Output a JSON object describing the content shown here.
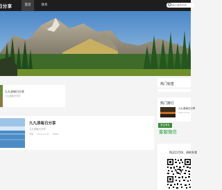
{
  "app": {
    "brand": "日分享"
  },
  "nav": {
    "items": [
      {
        "label": "首页"
      },
      {
        "label": "联系"
      }
    ]
  },
  "search": {
    "placeholder": "输入搜索内容"
  },
  "articles": [
    {
      "title": "九九浪每日分享",
      "subtitle": "九九浪每日分享",
      "meta": []
    },
    {
      "title": "九九浪每日分享",
      "subtitle": "九九浪每日分享",
      "meta": [
        "博客",
        "2024-12-30",
        "18882"
      ]
    }
  ],
  "sidebar": {
    "hot_tags": {
      "title": "热门标签"
    },
    "hot_rank": {
      "title": "热门排行",
      "item": {
        "title": "九九浪每日分享",
        "date": "2024-12-30"
      }
    },
    "follow_label": "关注有礼",
    "service_label": "客服微信",
    "contact_text": "购买后尽快，请联系我"
  },
  "colors": {
    "topbar": "#1e1e1e",
    "accent_green": "#1a9e2e",
    "badge_green": "#3a8a3a"
  }
}
